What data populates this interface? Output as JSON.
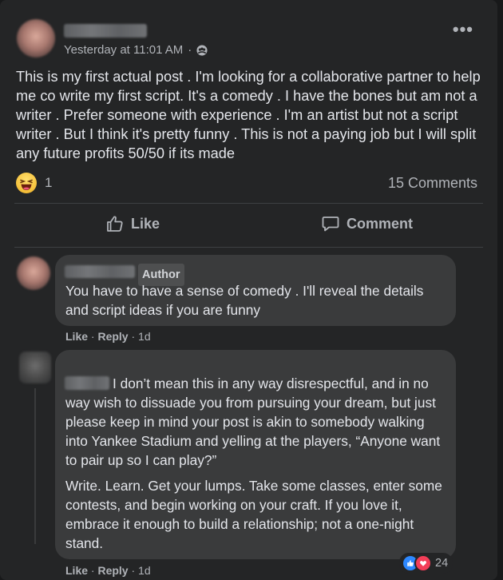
{
  "post": {
    "timestamp": "Yesterday at 11:01 AM",
    "privacy_icon": "group-icon",
    "more_label": "•••",
    "text": "This is my first actual post . I'm looking for a collaborative partner to help me co write my first script. It's a comedy . I have the bones but am not a writer . Prefer someone with experience . I'm an artist but not a script writer . But I think it's pretty funny . This is not a paying job but I will split any future profits 50/50 if its made",
    "reaction_icon": "haha-icon",
    "reaction_count": "1",
    "comments_count": "15 Comments"
  },
  "actions": {
    "like_label": "Like",
    "comment_label": "Comment"
  },
  "comments": [
    {
      "badge": "Author",
      "text": "You have to have a sense of comedy . I'll reveal the details and script ideas if you are funny",
      "like": "Like",
      "reply": "Reply",
      "age": "1d",
      "sep": "·"
    },
    {
      "text_p1": "I don’t mean this in any way disrespectful, and in no way wish to dissuade you from pursuing your dream, but just please keep in mind your post is akin to somebody walking into Yankee Stadium and yelling at the players, “Anyone want to pair up so I can play?”",
      "text_p2": "Write. Learn. Get your lumps. Take some classes, enter some contests, and begin working on your craft. If you love it, embrace it enough to build a relationship; not a one-night stand.",
      "like": "Like",
      "reply": "Reply",
      "age": "1d",
      "sep": "·",
      "reactions": {
        "icons": [
          "like-icon",
          "love-icon"
        ],
        "count": "24"
      }
    }
  ],
  "colors": {
    "background": "#18191a",
    "card": "#242526",
    "bubble": "#3a3b3c",
    "text": "#e4e6eb",
    "muted": "#b0b3b8",
    "like_blue": "#2d88ff",
    "love_red": "#f33e58"
  }
}
